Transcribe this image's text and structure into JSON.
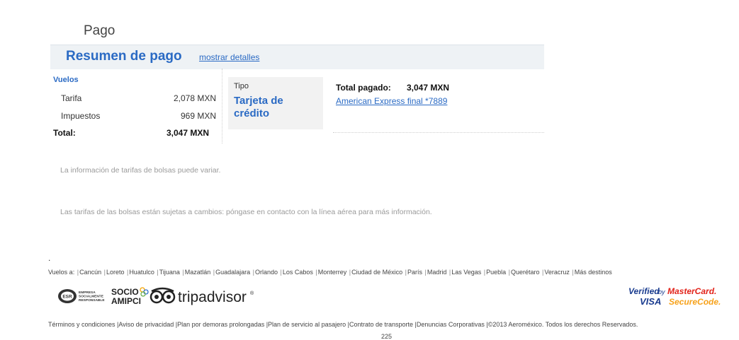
{
  "section_title": "Pago",
  "summary": {
    "title": "Resumen de pago",
    "details_link": "mostrar detalles"
  },
  "flights": {
    "title": "Vuelos",
    "rows": [
      {
        "label": "Tarifa",
        "value": "2,078 MXN"
      },
      {
        "label": "Impuestos",
        "value": "969 MXN"
      }
    ],
    "total_label": "Total:",
    "total_value": "3,047 MXN"
  },
  "payment": {
    "type_label": "Tipo",
    "type_value": "Tarjeta de crédito",
    "paid_label": "Total pagado:",
    "paid_value": "3,047 MXN",
    "card_link": "American Express final *7889"
  },
  "notes": [
    "La información de tarifas de bolsas puede variar.",
    "Las tarifas de las bolsas están sujetas a cambios: póngase en contacto con la línea aérea para más información."
  ],
  "dot": ".",
  "footer": {
    "flights_to_label": "Vuelos a:",
    "destinations": [
      "Cancún",
      "Loreto",
      "Huatulco",
      "Tijuana",
      "Mazatlán",
      "Guadalajara",
      "Orlando",
      "Los Cabos",
      "Monterrey",
      "Ciudad de México",
      "París",
      "Madrid",
      "Las Vegas",
      "Puebla",
      "Querétaro",
      "Veracruz",
      "Más destinos"
    ],
    "legal_links": [
      "Términos y condiciones",
      "Aviso de privacidad",
      "Plan por demoras prolongadas",
      "Plan de servicio al pasajero",
      "Contrato de transporte",
      "Denuncias Corporativas"
    ],
    "copyright": "©2013 Aeroméxico. Todos los derechos Reservados.",
    "cut_text": "225"
  },
  "logos": {
    "esr_lines": [
      "ESR",
      "EMPRESA",
      "SOCIALMENTE",
      "RESPONSABLE"
    ],
    "amipci_top": "SOCIO",
    "amipci_bottom": "AMIPCI",
    "tripadvisor": "tripadvisor",
    "tripadvisor_mark": "®",
    "verified_by": "Verified",
    "by_word": "by",
    "visa": "VISA",
    "mastercard": "MasterCard.",
    "securecode": "SecureCode."
  },
  "colors": {
    "accent": "#2a6ac4",
    "header_bg": "#eef2f5",
    "type_bg": "#f2f2f2",
    "note_text": "#9a9a9a",
    "mastercard_red": "#e2231a",
    "securecode_orange": "#f7a21b"
  }
}
